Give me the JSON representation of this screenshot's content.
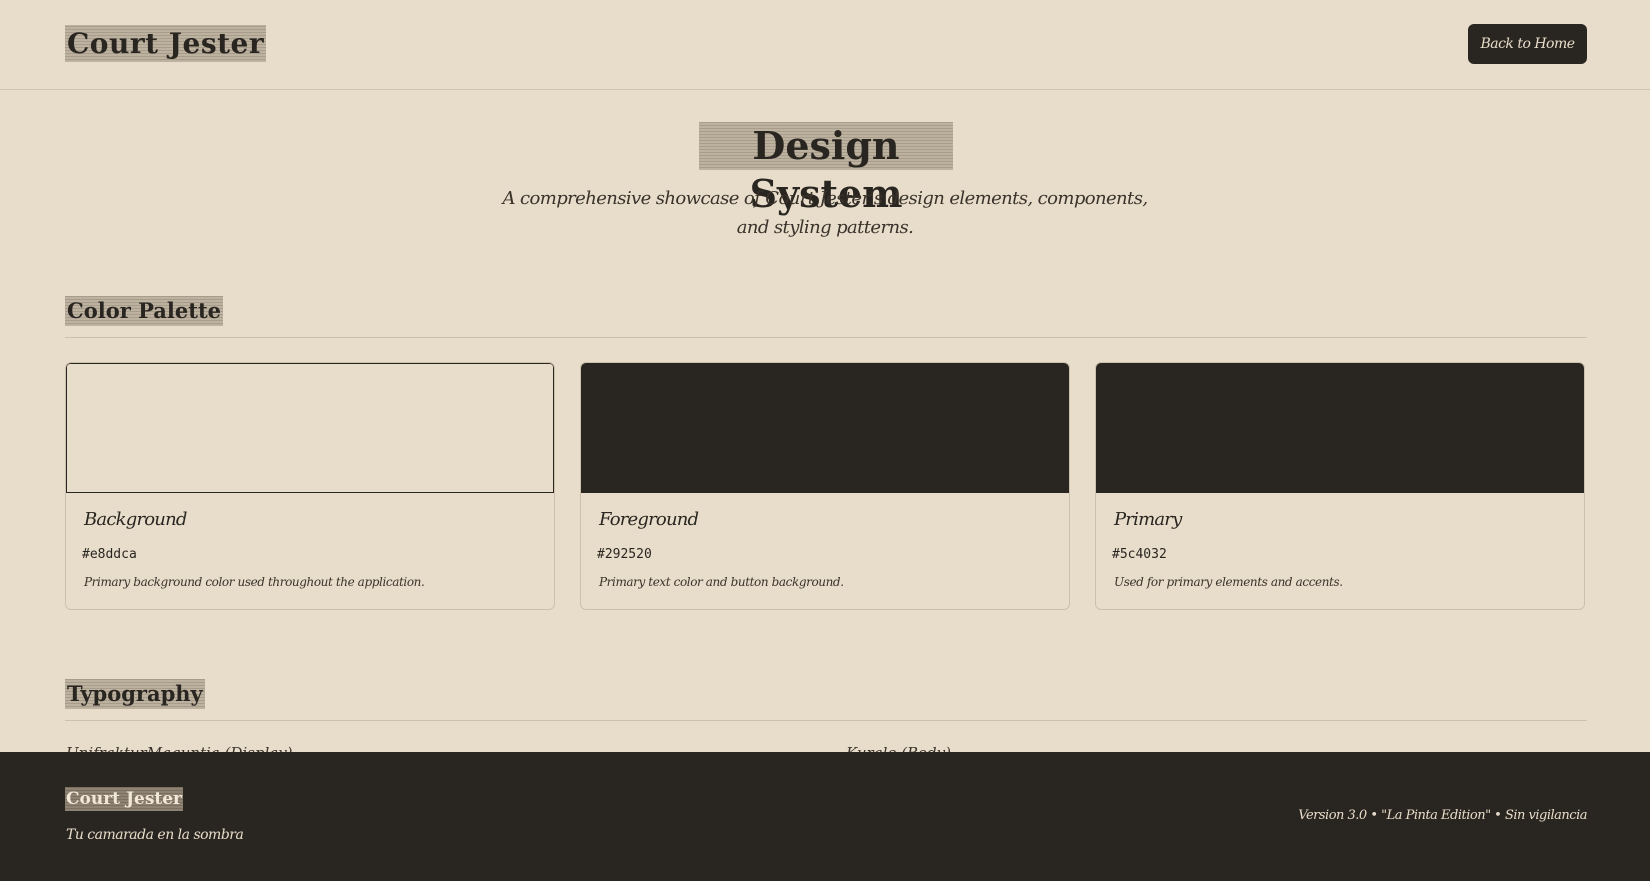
{
  "header": {
    "brand": "Court Jester",
    "back_button": "Back to Home"
  },
  "hero": {
    "title": "Design System",
    "subtitle": "A comprehensive showcase of Court Jester's design elements, components, and styling patterns."
  },
  "sections": {
    "colors_title": "Color Palette",
    "typography_title": "Typography"
  },
  "colors": [
    {
      "name": "Background",
      "hex": "#e8ddca",
      "description": "Primary background color used throughout the application."
    },
    {
      "name": "Foreground",
      "hex": "#292520",
      "description": "Primary text color and button background."
    },
    {
      "name": "Primary",
      "hex": "#5c4032",
      "description": "Used for primary elements and accents."
    }
  ],
  "typography_peek": {
    "left": "UnifrakturMaguntia (Display)",
    "right": "Kurale (Body)"
  },
  "footer": {
    "brand": "Court Jester",
    "tagline": "Tu camarada en la sombra",
    "version": "Version 3.0 • \"La Pinta Edition\" • Sin vigilancia"
  },
  "theme": {
    "background": "#e8ddca",
    "foreground": "#292520",
    "swatch_primary_rendered": "#292520"
  }
}
